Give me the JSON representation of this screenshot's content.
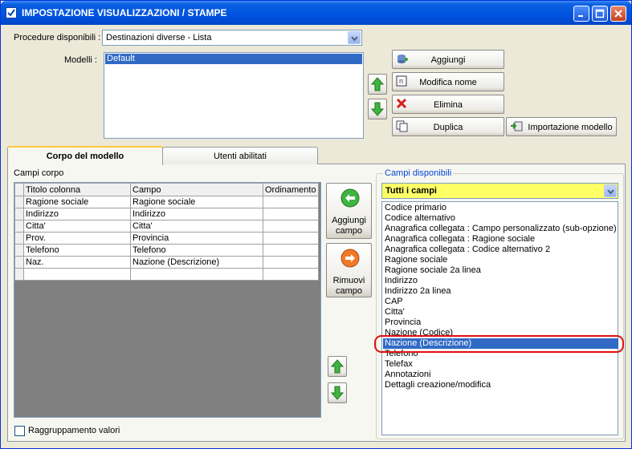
{
  "window": {
    "title": "IMPOSTAZIONE VISUALIZZAZIONI / STAMPE"
  },
  "procedure": {
    "label": "Procedure disponibili :",
    "value": "Destinazioni diverse - Lista"
  },
  "modelli": {
    "label": "Modelli :",
    "items": [
      "Default"
    ]
  },
  "buttons": {
    "aggiungi": "Aggiungi",
    "modifica": "Modifica nome",
    "elimina": "Elimina",
    "duplica": "Duplica",
    "importa": "Importazione modello"
  },
  "tabs": [
    "Corpo del modello",
    "Utenti abilitati"
  ],
  "campi_corpo": {
    "label": "Campi corpo",
    "headers": [
      "Titolo colonna",
      "Campo",
      "Ordinamento"
    ],
    "rows": [
      [
        "Ragione sociale",
        "Ragione sociale",
        ""
      ],
      [
        "Indirizzo",
        "Indirizzo",
        ""
      ],
      [
        "Citta'",
        "Citta'",
        ""
      ],
      [
        "Prov.",
        "Provincia",
        ""
      ],
      [
        "Telefono",
        "Telefono",
        ""
      ],
      [
        "Naz.",
        "Nazione (Descrizione)",
        ""
      ],
      [
        "",
        "",
        ""
      ]
    ]
  },
  "middle": {
    "aggiungi_campo": "Aggiungi campo",
    "rimuovi_campo": "Rimuovi campo"
  },
  "campi_disponibili": {
    "label": "Campi disponibili",
    "filter": "Tutti i campi",
    "items": [
      "Codice primario",
      "Codice alternativo",
      "Anagrafica collegata : Campo personalizzato (sub-opzione)",
      "Anagrafica collegata : Ragione sociale",
      "Anagrafica collegata : Codice alternativo 2",
      "Ragione sociale",
      "Ragione sociale 2a linea",
      "Indirizzo",
      "Indirizzo 2a linea",
      "CAP",
      "Citta'",
      "Provincia",
      "Nazione (Codice)",
      "Nazione (Descrizione)",
      "Telefono",
      "Telefax",
      "Annotazioni",
      "Dettagli creazione/modifica"
    ],
    "selected_index": 13
  },
  "raggruppamento": {
    "label": "Raggruppamento valori",
    "checked": false
  },
  "colors": {
    "selection": "#316AC5",
    "highlight": "#E01010",
    "filter_bg": "#FFFF66"
  }
}
